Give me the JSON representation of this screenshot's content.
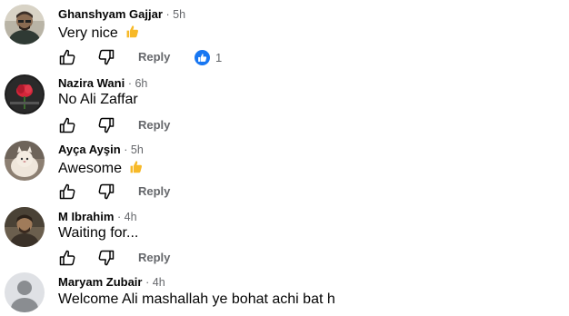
{
  "comments": [
    {
      "author": "Ghanshyam Gajjar",
      "time": "· 5h",
      "text": "Very nice",
      "emoji": "thumbs-up",
      "reply_label": "Reply",
      "reaction_count": "1"
    },
    {
      "author": "Nazira Wani",
      "time": "· 6h",
      "text": "No Ali Zaffar",
      "reply_label": "Reply"
    },
    {
      "author": "Ayça Ayşin",
      "time": "· 5h",
      "text": "Awesome",
      "emoji": "thumbs-up",
      "reply_label": "Reply"
    },
    {
      "author": "M Ibrahim",
      "time": "· 4h",
      "text": "Waiting for...",
      "reply_label": "Reply"
    },
    {
      "author": "Maryam Zubair",
      "time": "· 4h",
      "text": "Welcome Ali mashallah ye bohat achi bat h"
    }
  ],
  "colors": {
    "meta_gray": "#65676b",
    "like_blue": "#1877f2",
    "emoji_yellow": "#f7b928"
  },
  "icons": {
    "like": "thumbs-up-outline-icon",
    "dislike": "thumbs-down-outline-icon",
    "reaction": "like-reaction-icon"
  }
}
